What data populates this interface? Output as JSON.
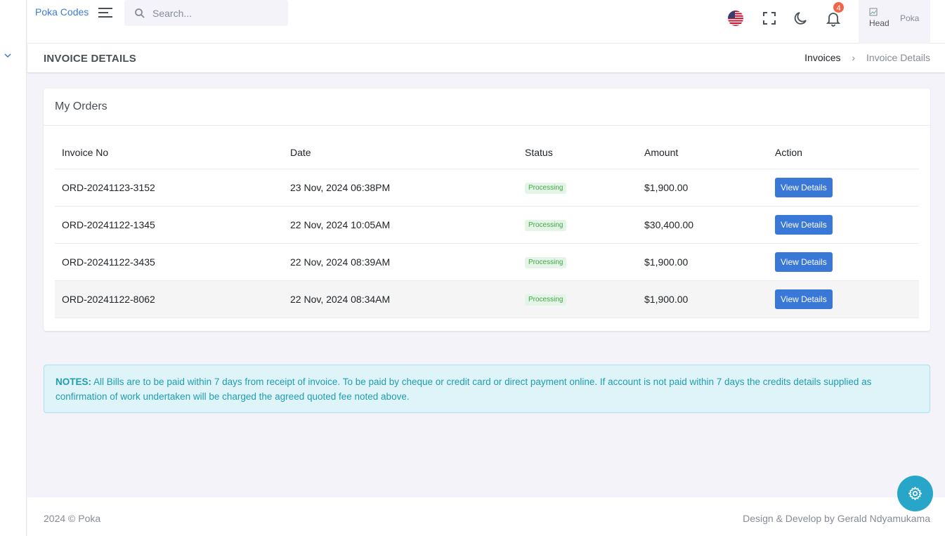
{
  "topbar": {
    "brand": "Poka Codes",
    "search_placeholder": "Search...",
    "notification_count": "4",
    "avatar_alt": "Head",
    "user_name": "Poka"
  },
  "page": {
    "title": "INVOICE DETAILS",
    "breadcrumb": [
      "Invoices",
      "Invoice Details"
    ]
  },
  "orders": {
    "title": "My Orders",
    "columns": [
      "Invoice No",
      "Date",
      "Status",
      "Amount",
      "Action"
    ],
    "rows": [
      {
        "invoice": "ORD-20241123-3152",
        "date": "23 Nov, 2024 06:38PM",
        "status": "Processing",
        "amount": "$1,900.00",
        "action": "View Details"
      },
      {
        "invoice": "ORD-20241122-1345",
        "date": "22 Nov, 2024 10:05AM",
        "status": "Processing",
        "amount": "$30,400.00",
        "action": "View Details"
      },
      {
        "invoice": "ORD-20241122-3435",
        "date": "22 Nov, 2024 08:39AM",
        "status": "Processing",
        "amount": "$1,900.00",
        "action": "View Details"
      },
      {
        "invoice": "ORD-20241122-8062",
        "date": "22 Nov, 2024 08:34AM",
        "status": "Processing",
        "amount": "$1,900.00",
        "action": "View Details"
      }
    ]
  },
  "notes": {
    "label": "NOTES:",
    "text": " All Bills are to be paid within 7 days from receipt of invoice. To be paid by cheque or credit card or direct payment online. If account is not paid within 7 days the credits details supplied as confirmation of work undertaken will be charged the agreed quoted fee noted above."
  },
  "footer": {
    "copyright": "2024 © Poka",
    "credit": "Design & Develop by Gerald Ndyamukama"
  },
  "colors": {
    "primary": "#3a78d8",
    "status_success": "#43a74a",
    "notes_text": "#1e9db2",
    "badge": "#f06548"
  },
  "icons": [
    "chevron-down-icon",
    "hamburger-icon",
    "search-icon",
    "us-flag-icon",
    "fullscreen-icon",
    "moon-icon",
    "bell-icon",
    "settings-gear-icon"
  ]
}
